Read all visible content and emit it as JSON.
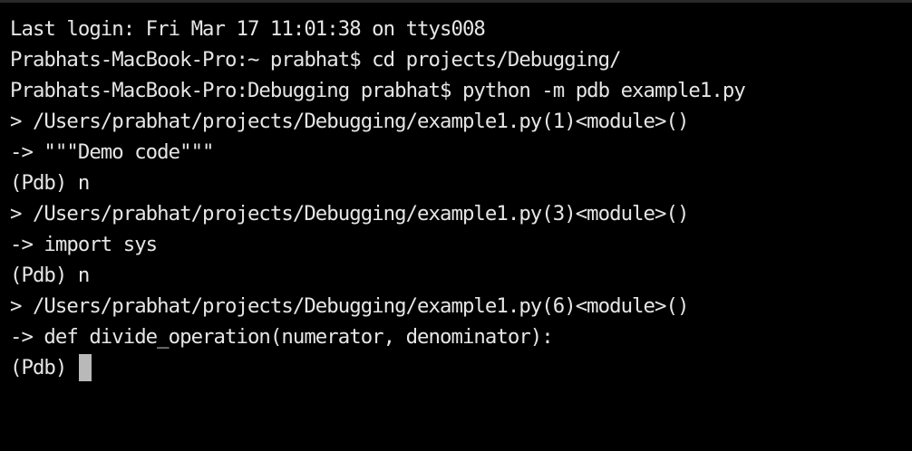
{
  "terminal": {
    "lines": [
      "Last login: Fri Mar 17 11:01:38 on ttys008",
      "Prabhats-MacBook-Pro:~ prabhat$ cd projects/Debugging/",
      "Prabhats-MacBook-Pro:Debugging prabhat$ python -m pdb example1.py",
      "> /Users/prabhat/projects/Debugging/example1.py(1)<module>()",
      "-> \"\"\"Demo code\"\"\"",
      "(Pdb) n",
      "> /Users/prabhat/projects/Debugging/example1.py(3)<module>()",
      "-> import sys",
      "(Pdb) n",
      "> /Users/prabhat/projects/Debugging/example1.py(6)<module>()",
      "-> def divide_operation(numerator, denominator):"
    ],
    "prompt": "(Pdb)",
    "colors": {
      "background": "#000000",
      "text": "#e6e6e6",
      "cursor": "#b9b9b9"
    }
  }
}
